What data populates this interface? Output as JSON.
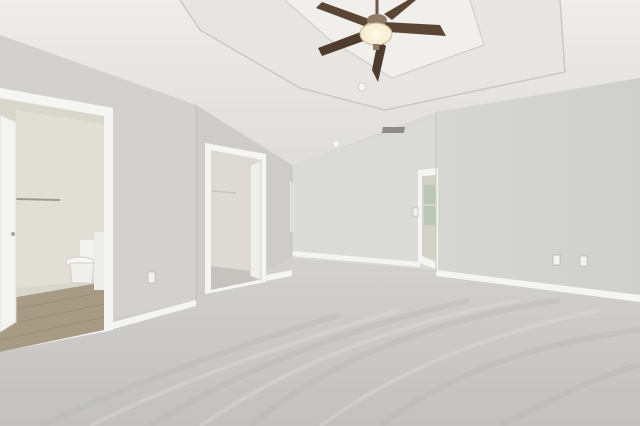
{
  "scene": {
    "kind": "photo",
    "subject": "empty-room-interior",
    "colors": {
      "ceiling": "#e9e8e4",
      "ceiling_shadow": "#d6d5d1",
      "wall_left": "#d3d2ce",
      "wall_back": "#dcdcd8",
      "wall_right": "#d8d8d4",
      "trim": "#f7f7f5",
      "carpet": "#c9c8c6",
      "carpet_dark": "#b9b8b6",
      "bath_floor": "#a89b85",
      "fan_blade": "#5b4636",
      "fan_light": "#f6efd6"
    }
  }
}
